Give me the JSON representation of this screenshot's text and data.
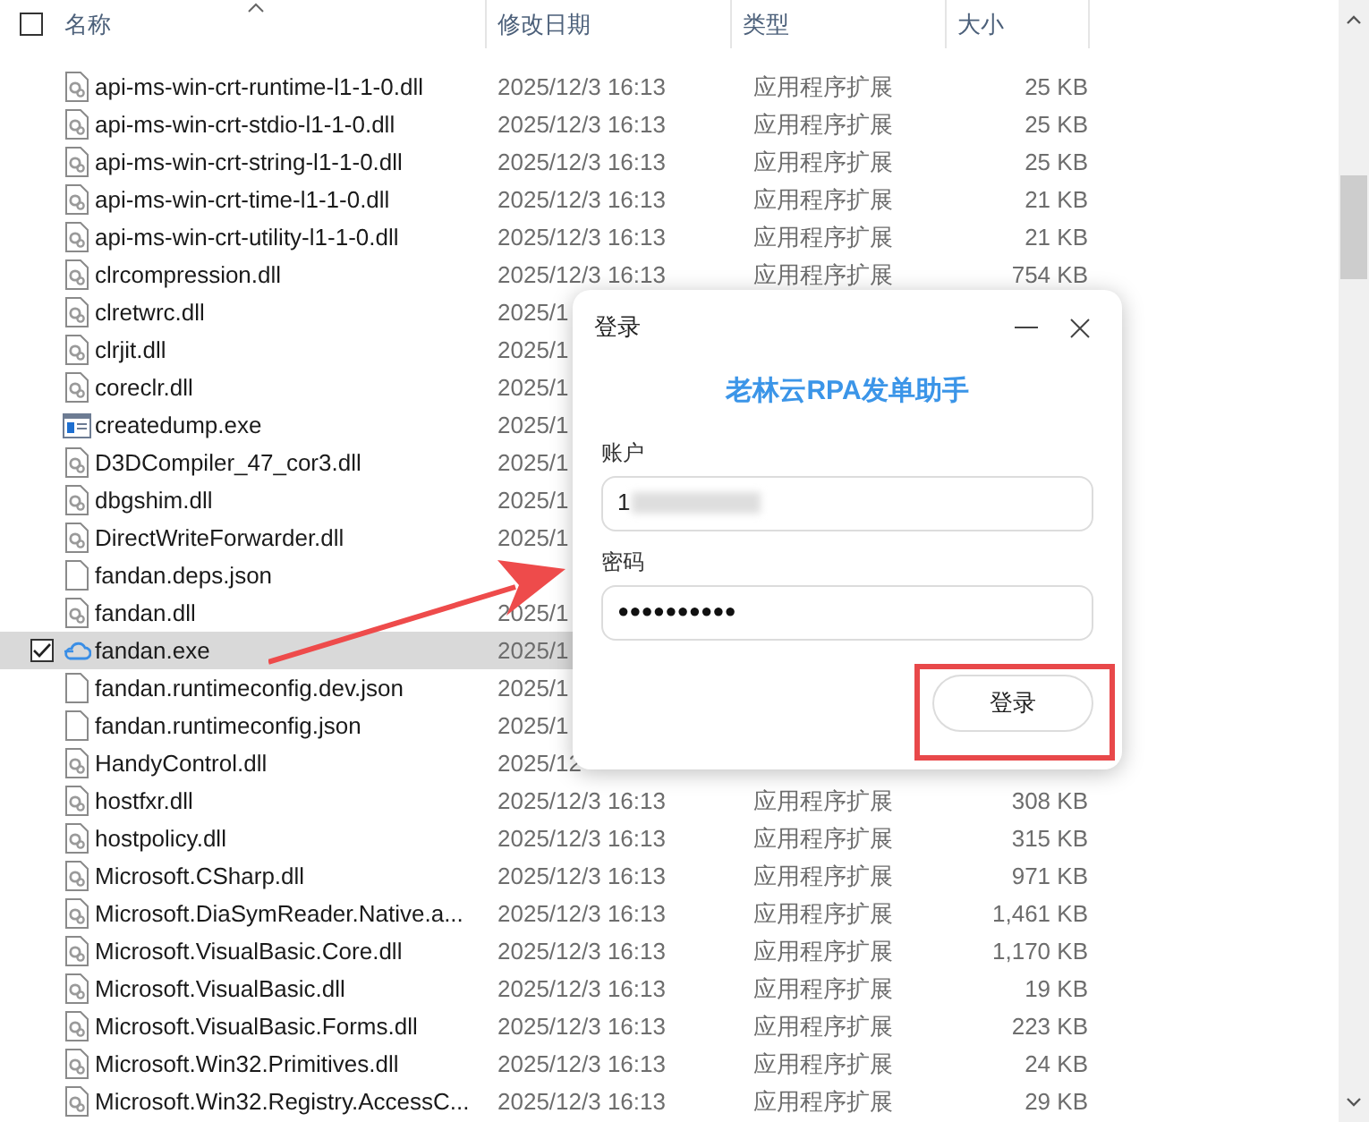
{
  "header": {
    "select_all_checked": false,
    "columns": [
      {
        "label": "名称",
        "sorted": true
      },
      {
        "label": "修改日期",
        "sorted": false
      },
      {
        "label": "类型",
        "sorted": false
      },
      {
        "label": "大小",
        "sorted": false
      }
    ]
  },
  "rows": [
    {
      "kind": "dll",
      "name": "api-ms-win-crt-runtime-l1-1-0.dll",
      "date": "2025/12/3 16:13",
      "type": "应用程序扩展",
      "size": "25 KB",
      "selected": false
    },
    {
      "kind": "dll",
      "name": "api-ms-win-crt-stdio-l1-1-0.dll",
      "date": "2025/12/3 16:13",
      "type": "应用程序扩展",
      "size": "25 KB",
      "selected": false
    },
    {
      "kind": "dll",
      "name": "api-ms-win-crt-string-l1-1-0.dll",
      "date": "2025/12/3 16:13",
      "type": "应用程序扩展",
      "size": "25 KB",
      "selected": false
    },
    {
      "kind": "dll",
      "name": "api-ms-win-crt-time-l1-1-0.dll",
      "date": "2025/12/3 16:13",
      "type": "应用程序扩展",
      "size": "21 KB",
      "selected": false
    },
    {
      "kind": "dll",
      "name": "api-ms-win-crt-utility-l1-1-0.dll",
      "date": "2025/12/3 16:13",
      "type": "应用程序扩展",
      "size": "21 KB",
      "selected": false
    },
    {
      "kind": "dll",
      "name": "clrcompression.dll",
      "date": "2025/12/3 16:13",
      "type": "应用程序扩展",
      "size": "754 KB",
      "selected": false
    },
    {
      "kind": "dll",
      "name": "clretwrc.dll",
      "date": "2025/1",
      "selected": false
    },
    {
      "kind": "dll",
      "name": "clrjit.dll",
      "date": "2025/1",
      "selected": false
    },
    {
      "kind": "dll",
      "name": "coreclr.dll",
      "date": "2025/1",
      "selected": false
    },
    {
      "kind": "exe",
      "name": "createdump.exe",
      "date": "2025/1",
      "selected": false
    },
    {
      "kind": "dll",
      "name": "D3DCompiler_47_cor3.dll",
      "date": "2025/1",
      "selected": false
    },
    {
      "kind": "dll",
      "name": "dbgshim.dll",
      "date": "2025/1",
      "selected": false
    },
    {
      "kind": "dll",
      "name": "DirectWriteForwarder.dll",
      "date": "2025/1",
      "selected": false
    },
    {
      "kind": "file",
      "name": "fandan.deps.json",
      "selected": false
    },
    {
      "kind": "dll",
      "name": "fandan.dll",
      "date": "2025/1",
      "selected": false
    },
    {
      "kind": "app",
      "name": "fandan.exe",
      "date": "2025/1",
      "selected": true
    },
    {
      "kind": "file",
      "name": "fandan.runtimeconfig.dev.json",
      "date": "2025/1",
      "selected": false
    },
    {
      "kind": "file",
      "name": "fandan.runtimeconfig.json",
      "date": "2025/1",
      "selected": false
    },
    {
      "kind": "dll",
      "name": "HandyControl.dll",
      "date": "2025/12",
      "selected": false
    },
    {
      "kind": "dll",
      "name": "hostfxr.dll",
      "date": "2025/12/3 16:13",
      "type": "应用程序扩展",
      "size": "308 KB",
      "selected": false
    },
    {
      "kind": "dll",
      "name": "hostpolicy.dll",
      "date": "2025/12/3 16:13",
      "type": "应用程序扩展",
      "size": "315 KB",
      "selected": false
    },
    {
      "kind": "dll",
      "name": "Microsoft.CSharp.dll",
      "date": "2025/12/3 16:13",
      "type": "应用程序扩展",
      "size": "971 KB",
      "selected": false
    },
    {
      "kind": "dll",
      "name": "Microsoft.DiaSymReader.Native.a...",
      "date": "2025/12/3 16:13",
      "type": "应用程序扩展",
      "size": "1,461 KB",
      "selected": false
    },
    {
      "kind": "dll",
      "name": "Microsoft.VisualBasic.Core.dll",
      "date": "2025/12/3 16:13",
      "type": "应用程序扩展",
      "size": "1,170 KB",
      "selected": false
    },
    {
      "kind": "dll",
      "name": "Microsoft.VisualBasic.dll",
      "date": "2025/12/3 16:13",
      "type": "应用程序扩展",
      "size": "19 KB",
      "selected": false
    },
    {
      "kind": "dll",
      "name": "Microsoft.VisualBasic.Forms.dll",
      "date": "2025/12/3 16:13",
      "type": "应用程序扩展",
      "size": "223 KB",
      "selected": false
    },
    {
      "kind": "dll",
      "name": "Microsoft.Win32.Primitives.dll",
      "date": "2025/12/3 16:13",
      "type": "应用程序扩展",
      "size": "24 KB",
      "selected": false
    },
    {
      "kind": "dll",
      "name": "Microsoft.Win32.Registry.AccessC...",
      "date": "2025/12/3 16:13",
      "type": "应用程序扩展",
      "size": "29 KB",
      "selected": false
    }
  ],
  "dialog": {
    "title": "登录",
    "app_title": "老林云RPA发单助手",
    "account_label": "账户",
    "account_value": "1",
    "password_label": "密码",
    "password_value": "●●●●●●●●●●",
    "login_button": "登录"
  }
}
